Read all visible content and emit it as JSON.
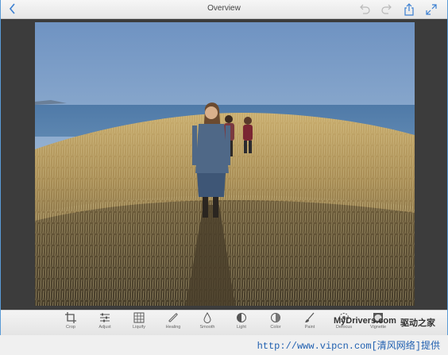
{
  "header": {
    "title": "Overview",
    "back_icon": "chevron-left-icon",
    "undo_icon": "undo-icon",
    "redo_icon": "redo-icon",
    "share_icon": "share-icon",
    "expand_icon": "expand-icon"
  },
  "toolbar": {
    "items": [
      {
        "label": "Crop",
        "icon": "crop-icon"
      },
      {
        "label": "Adjust",
        "icon": "sliders-icon"
      },
      {
        "label": "Liquify",
        "icon": "grid-icon"
      },
      {
        "label": "Healing",
        "icon": "bandage-icon"
      },
      {
        "label": "Smooth",
        "icon": "droplet-icon"
      },
      {
        "label": "Light",
        "icon": "half-circle-icon"
      },
      {
        "label": "Color",
        "icon": "contrast-icon"
      },
      {
        "label": "Paint",
        "icon": "brush-icon"
      },
      {
        "label": "Defocus",
        "icon": "defocus-icon"
      },
      {
        "label": "Vignette",
        "icon": "vignette-icon"
      }
    ]
  },
  "watermark": {
    "site": "MyDrivers.com",
    "name": "驱动之家"
  },
  "footer": {
    "text": "http://www.vipcn.com[清风网络]提供"
  },
  "colors": {
    "accent": "#3b7fd1",
    "sky": "#86a6c8",
    "grass": "#b59a62"
  }
}
